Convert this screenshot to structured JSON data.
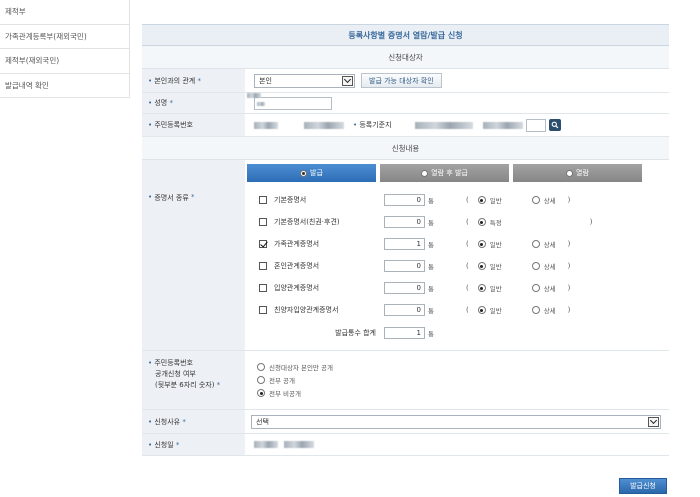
{
  "sidebar": {
    "items": [
      {
        "label": "제적부"
      },
      {
        "label": "가족관계등록부(재외국민)"
      },
      {
        "label": "제적부(재외국민)"
      },
      {
        "label": "발급내역 확인"
      }
    ]
  },
  "main": {
    "title": "등록사항별 증명서 열람/발급 신청",
    "section_applicant": "신청대상자",
    "section_content": "신청내용"
  },
  "fields": {
    "relation_label": "본인과의 관계",
    "relation_value": "본인",
    "relation_button": "발급 가능 대상자 확인",
    "name_label": "성명",
    "rrn_label": "주민등록번호",
    "reg_base_label": "등록기준지",
    "cert_type_label": "증명서 종류",
    "disclosure_label_1": "주민등록번호",
    "disclosure_label_2": "공개신청 여부",
    "disclosure_label_3": "(뒷부분 6자리 숫자)",
    "reason_label": "신청사유",
    "reason_value": "선택",
    "date_label": "신청일"
  },
  "tabs": [
    {
      "label": "발급",
      "active": true
    },
    {
      "label": "열람 후 발급",
      "active": false
    },
    {
      "label": "열람",
      "active": false
    }
  ],
  "unit": "통",
  "option_general": "일반",
  "option_detail": "상세",
  "option_special": "특정",
  "certificates": [
    {
      "name": "기본증명서",
      "checked": false,
      "qty": "0",
      "type": "일반",
      "has_detail": true
    },
    {
      "name": "기본증명서(친권·후견)",
      "checked": false,
      "qty": "0",
      "type": "특정",
      "has_detail": false
    },
    {
      "name": "가족관계증명서",
      "checked": true,
      "qty": "1",
      "type": "일반",
      "has_detail": true
    },
    {
      "name": "혼인관계증명서",
      "checked": false,
      "qty": "0",
      "type": "일반",
      "has_detail": true
    },
    {
      "name": "입양관계증명서",
      "checked": false,
      "qty": "0",
      "type": "일반",
      "has_detail": true
    },
    {
      "name": "친양자입양관계증명서",
      "checked": false,
      "qty": "0",
      "type": "일반",
      "has_detail": true
    }
  ],
  "total": {
    "label": "발급통수 합계",
    "value": "1"
  },
  "disclosure_options": [
    {
      "label": "신청대상자 본인만 공개",
      "selected": false
    },
    {
      "label": "전부 공개",
      "selected": false
    },
    {
      "label": "전부 비공개",
      "selected": true
    }
  ],
  "submit_label": "발급신청",
  "colors": {
    "accent": "#2c6db5",
    "header_bg": "#e9eff5",
    "label_bg": "#edf1f5"
  }
}
